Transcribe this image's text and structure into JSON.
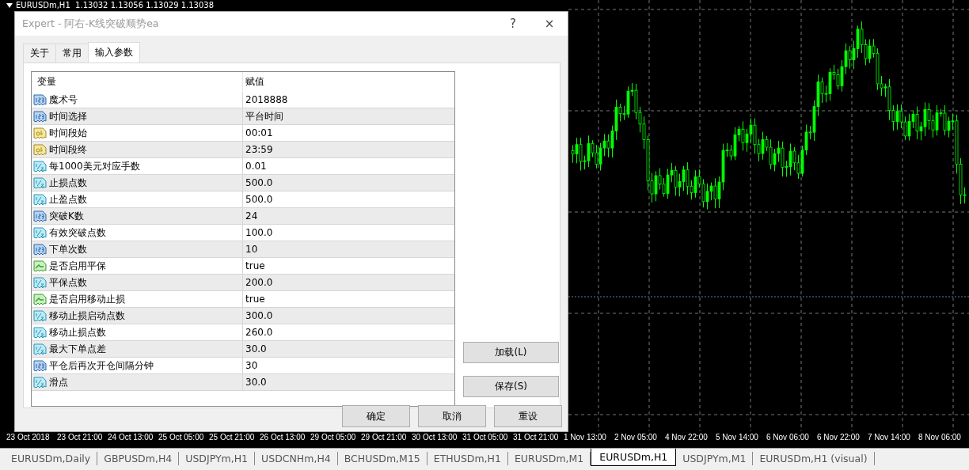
{
  "chart": {
    "header": "EURUSDm,H1  1.13032 1.13056 1.13029 1.13038",
    "time_labels": [
      "23 Oct 2018",
      "23 Oct 21:00",
      "24 Oct 13:00",
      "25 Oct 05:00",
      "25 Oct 21:00",
      "26 Oct 13:00",
      "29 Oct 05:00",
      "29 Oct 21:00",
      "30 Oct 13:00",
      "31 Oct 05:00",
      "31 Oct 21:00",
      "1 Nov 13:00",
      "2 Nov 05:00",
      "4 Nov 22:00",
      "5 Nov 14:00",
      "6 Nov 06:00",
      "6 Nov 22:00",
      "7 Nov 14:00",
      "8 Nov 06:00"
    ]
  },
  "dialog": {
    "title": "Expert - 阿右-K线突破顺势ea",
    "help": "?",
    "close": "×",
    "tabs": [
      {
        "label": "关于",
        "selected": false
      },
      {
        "label": "常用",
        "selected": false
      },
      {
        "label": "输入参数",
        "selected": true
      }
    ],
    "table": {
      "columns": [
        "变量",
        "赋值"
      ],
      "rows": [
        {
          "kind": "int",
          "name": "魔术号",
          "value": "2018888"
        },
        {
          "kind": "int",
          "name": "时间选择",
          "value": "平台时间"
        },
        {
          "kind": "string",
          "name": "时间段始",
          "value": "00:01"
        },
        {
          "kind": "string",
          "name": "时间段终",
          "value": "23:59"
        },
        {
          "kind": "double",
          "name": "每1000美元对应手数",
          "value": "0.01"
        },
        {
          "kind": "double",
          "name": "止损点数",
          "value": "500.0"
        },
        {
          "kind": "double",
          "name": "止盈点数",
          "value": "500.0"
        },
        {
          "kind": "int",
          "name": "突破K数",
          "value": "24"
        },
        {
          "kind": "double",
          "name": "有效突破点数",
          "value": "100.0"
        },
        {
          "kind": "int",
          "name": "下单次数",
          "value": "10"
        },
        {
          "kind": "bool",
          "name": "是否启用平保",
          "value": "true"
        },
        {
          "kind": "double",
          "name": "平保点数",
          "value": "200.0"
        },
        {
          "kind": "bool",
          "name": "是否启用移动止损",
          "value": "true"
        },
        {
          "kind": "double",
          "name": "移动止损启动点数",
          "value": "300.0"
        },
        {
          "kind": "double",
          "name": "移动止损点数",
          "value": "260.0"
        },
        {
          "kind": "double",
          "name": "最大下单点差",
          "value": "30.0"
        },
        {
          "kind": "int",
          "name": "平仓后再次开仓间隔分钟",
          "value": "30"
        },
        {
          "kind": "double",
          "name": "滑点",
          "value": "30.0"
        }
      ]
    },
    "side_buttons": [
      "加载(L)",
      "保存(S)"
    ],
    "bottom_buttons": [
      "确定",
      "取消",
      "重设"
    ]
  },
  "symbol_tabs": [
    {
      "label": "EURUSDm,Daily",
      "selected": false
    },
    {
      "label": "GBPUSDm,H4",
      "selected": false
    },
    {
      "label": "USDJPYm,H1",
      "selected": false
    },
    {
      "label": "USDCNHm,H4",
      "selected": false
    },
    {
      "label": "BCHUSDm,M15",
      "selected": false
    },
    {
      "label": "ETHUSDm,H1",
      "selected": false
    },
    {
      "label": "EURUSDm,M1",
      "selected": false
    },
    {
      "label": "EURUSDm,H1",
      "selected": true
    },
    {
      "label": "USDJPYm,M1",
      "selected": false
    },
    {
      "label": "EURUSDm,H1 (visual)",
      "selected": false
    }
  ]
}
